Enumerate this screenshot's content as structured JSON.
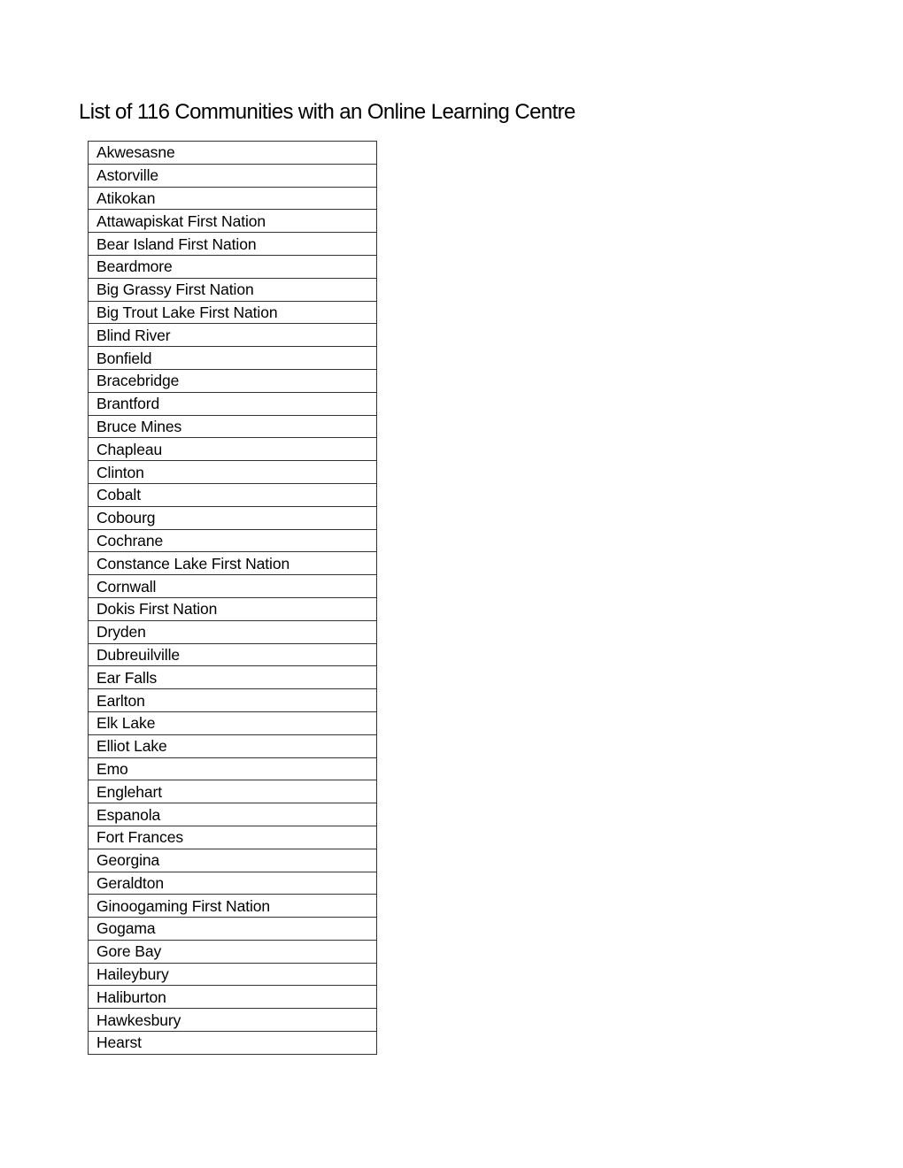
{
  "document": {
    "title": "List of 116 Communities with an Online Learning Centre",
    "communities": [
      "Akwesasne",
      "Astorville",
      "Atikokan",
      "Attawapiskat First Nation",
      "Bear Island First Nation",
      "Beardmore",
      "Big Grassy First Nation",
      "Big Trout Lake First Nation",
      "Blind River",
      "Bonfield",
      "Bracebridge",
      "Brantford",
      "Bruce Mines",
      "Chapleau",
      "Clinton",
      "Cobalt",
      "Cobourg",
      "Cochrane",
      "Constance Lake First Nation",
      "Cornwall",
      "Dokis First Nation",
      "Dryden",
      "Dubreuilville",
      "Ear Falls",
      "Earlton",
      "Elk Lake",
      "Elliot Lake",
      "Emo",
      "Englehart",
      "Espanola",
      "Fort Frances",
      "Georgina",
      "Geraldton",
      "Ginoogaming First Nation",
      "Gogama",
      "Gore Bay",
      "Haileybury",
      "Haliburton",
      "Hawkesbury",
      "Hearst"
    ]
  }
}
